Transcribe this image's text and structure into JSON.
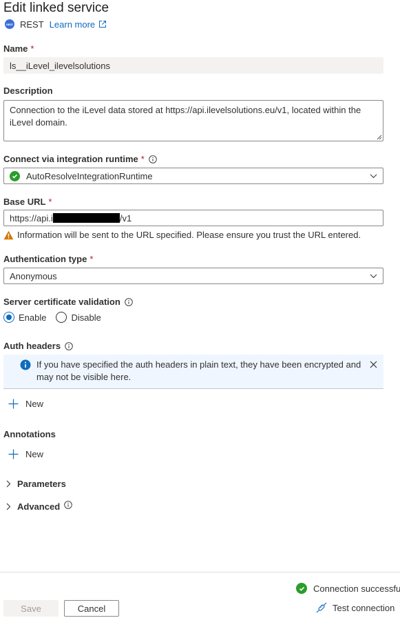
{
  "header": {
    "title": "Edit linked service",
    "service_icon": "rest-icon",
    "service_icon_text": "REST",
    "service_name": "REST",
    "learn_more": "Learn more"
  },
  "name": {
    "label": "Name",
    "required_mark": "*",
    "value": "ls__iLevel_ilevelsolutions"
  },
  "description": {
    "label": "Description",
    "value": "Connection to the iLevel data stored at https://api.ilevelsolutions.eu/v1, located within the iLevel domain."
  },
  "integration_runtime": {
    "label": "Connect via integration runtime",
    "required_mark": "*",
    "value": "AutoResolveIntegrationRuntime",
    "status_icon": "check-circle-icon"
  },
  "base_url": {
    "label": "Base URL",
    "required_mark": "*",
    "value_prefix": "https://api.i",
    "value_suffix": "/v1",
    "warning": "Information will be sent to the URL specified. Please ensure you trust the URL entered."
  },
  "authentication": {
    "label": "Authentication type",
    "required_mark": "*",
    "value": "Anonymous"
  },
  "server_cert": {
    "label": "Server certificate validation",
    "options": [
      {
        "label": "Enable",
        "selected": true
      },
      {
        "label": "Disable",
        "selected": false
      }
    ]
  },
  "auth_headers": {
    "label": "Auth headers",
    "banner": "If you have specified the auth headers in plain text, they have been encrypted and may not be visible here.",
    "new_label": "New"
  },
  "annotations": {
    "label": "Annotations",
    "new_label": "New"
  },
  "sections": {
    "parameters": "Parameters",
    "advanced": "Advanced"
  },
  "footer": {
    "connection_status": "Connection successful",
    "save_label": "Save",
    "cancel_label": "Cancel",
    "test_connection_label": "Test connection"
  },
  "colors": {
    "accent": "#0f6cbd",
    "success": "#2a9d2a",
    "warning": "#d47500",
    "required": "#a4262c"
  }
}
